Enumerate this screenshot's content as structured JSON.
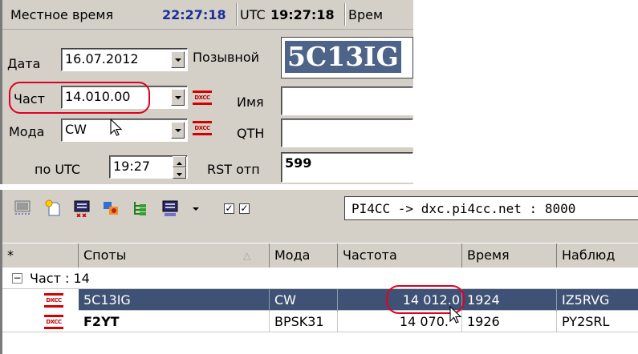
{
  "status_bar": {
    "local_label": "Местное время",
    "local_time": "22:27:18",
    "utc_label": "UTC",
    "utc_time": "19:27:18",
    "next_label": "Врем"
  },
  "qso_form": {
    "date_label": "Дата",
    "date_value": "16.07.2012",
    "freq_label": "Част",
    "freq_value": "14.010.00",
    "mode_label": "Мода",
    "mode_value": "CW",
    "utc_label": "по UTC",
    "utc_value": "19:27",
    "callsign_label": "Позывной",
    "callsign_value": "5C13IG",
    "name_label": "Имя",
    "qth_label": "QTH",
    "rst_label": "RST отп",
    "rst_value": "599",
    "dxcc_badge": "DXCC"
  },
  "toolbar": {
    "icons": [
      "telnet-icon",
      "new-spot-icon",
      "telnet-disconnect-icon",
      "filter-icon",
      "tree-icon",
      "telnet-settings-icon",
      "dropdown-arrow-icon"
    ],
    "cluster_value": "PI4CC -> dxc.pi4cc.net : 8000"
  },
  "spots_table": {
    "columns": [
      "*",
      "Споты",
      "Мода",
      "Частота",
      "Время",
      "Наблюд"
    ],
    "group_label": "Част : 14",
    "group_toggle": "−",
    "rows": [
      {
        "badge": "DXCC",
        "call": "5C13IG",
        "mode": "CW",
        "freq": "14 012.0",
        "time": "1924",
        "spotter": "IZ5RVG"
      },
      {
        "badge": "DXCC",
        "call": "F2YT",
        "mode": "BPSK31",
        "freq": "14 070.",
        "time": "1926",
        "spotter": "PY2SRL"
      }
    ]
  },
  "colors": {
    "panel": "#d4d0c8",
    "selection": "#3f5276",
    "highlight_ring": "#e00020",
    "time_blue": "#1a2f9a",
    "dxcc_red": "#d40000"
  }
}
